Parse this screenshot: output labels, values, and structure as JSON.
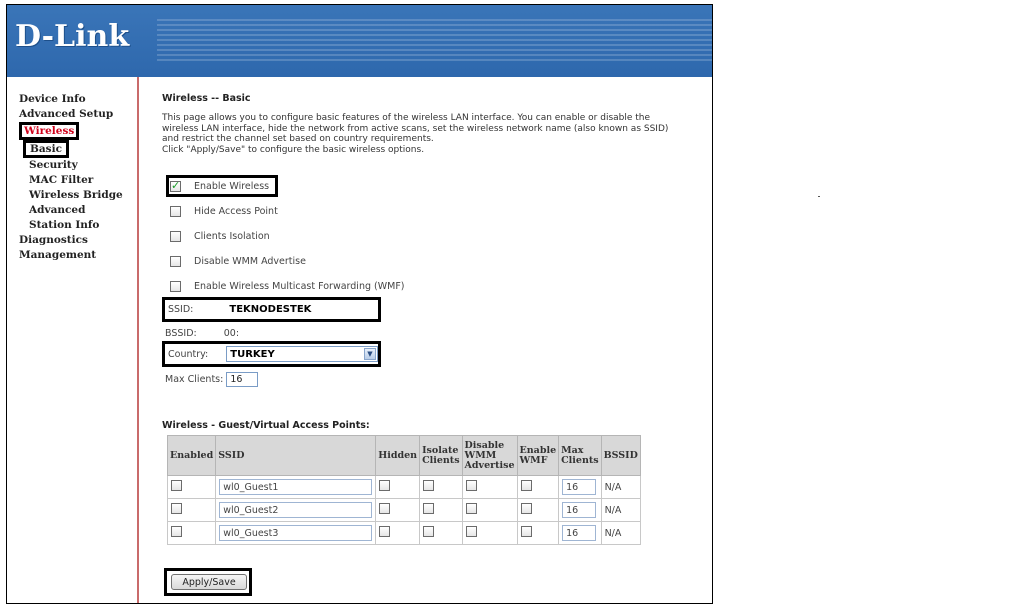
{
  "brand": {
    "logo_text": "D-Link"
  },
  "sidebar": {
    "items": [
      {
        "label": "Device Info"
      },
      {
        "label": "Advanced Setup"
      },
      {
        "label": "Wireless"
      },
      {
        "label": "Basic"
      },
      {
        "label": "Security"
      },
      {
        "label": "MAC Filter"
      },
      {
        "label": "Wireless Bridge"
      },
      {
        "label": "Advanced"
      },
      {
        "label": "Station Info"
      },
      {
        "label": "Diagnostics"
      },
      {
        "label": "Management"
      }
    ]
  },
  "main": {
    "title": "Wireless -- Basic",
    "description_lines": [
      "This page allows you to configure basic features of the wireless LAN interface. You can enable or disable the",
      "wireless LAN interface, hide the network from active scans, set the wireless network name (also known as SSID)",
      "and restrict the channel set based on country requirements.",
      "Click \"Apply/Save\" to configure the basic wireless options."
    ],
    "options": [
      {
        "label": "Enable Wireless",
        "checked": true
      },
      {
        "label": "Hide Access Point",
        "checked": false
      },
      {
        "label": "Clients Isolation",
        "checked": false
      },
      {
        "label": "Disable WMM Advertise",
        "checked": false
      },
      {
        "label": "Enable Wireless Multicast Forwarding (WMF)",
        "checked": false
      }
    ],
    "ssid_label": "SSID:",
    "ssid_value": "TEKNODESTEK",
    "bssid_label": "BSSID:",
    "bssid_value": "00:",
    "country_label": "Country:",
    "country_value": "TURKEY",
    "max_clients_label": "Max Clients:",
    "max_clients_value": "16",
    "guest_section_title": "Wireless - Guest/Virtual Access Points:",
    "guest_table": {
      "headers": [
        "Enabled",
        "SSID",
        "Hidden",
        "Isolate Clients",
        "Disable WMM Advertise",
        "Enable WMF",
        "Max Clients",
        "BSSID"
      ],
      "rows": [
        {
          "ssid": "wl0_Guest1",
          "max_clients": "16",
          "bssid": "N/A"
        },
        {
          "ssid": "wl0_Guest2",
          "max_clients": "16",
          "bssid": "N/A"
        },
        {
          "ssid": "wl0_Guest3",
          "max_clients": "16",
          "bssid": "N/A"
        }
      ]
    },
    "apply_label": "Apply/Save"
  }
}
